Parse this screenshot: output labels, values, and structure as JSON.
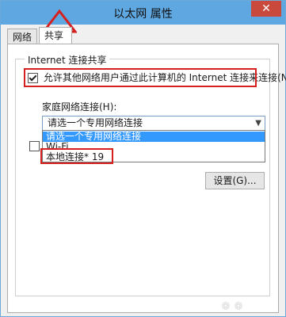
{
  "window": {
    "title": "以太网 属性",
    "close_glyph": "✕"
  },
  "tabs": [
    {
      "label": "网络"
    },
    {
      "label": "共享"
    }
  ],
  "group": {
    "title": "Internet 连接共享"
  },
  "allow_sharing": {
    "label": "允许其他网络用户通过此计算机的 Internet 连接来连接(N)",
    "checked": true
  },
  "home_network": {
    "label": "家庭网络连接(H):",
    "selected": "请选一个专用网络连接",
    "options": [
      "请选一个专用网络连接",
      "Wi-Fi",
      "本地连接* 19"
    ]
  },
  "settings_button": {
    "label": "设置(G)..."
  },
  "colors": {
    "highlight": "#d62020",
    "titlebar": "#5fa7e0",
    "selection": "#3399ff"
  }
}
